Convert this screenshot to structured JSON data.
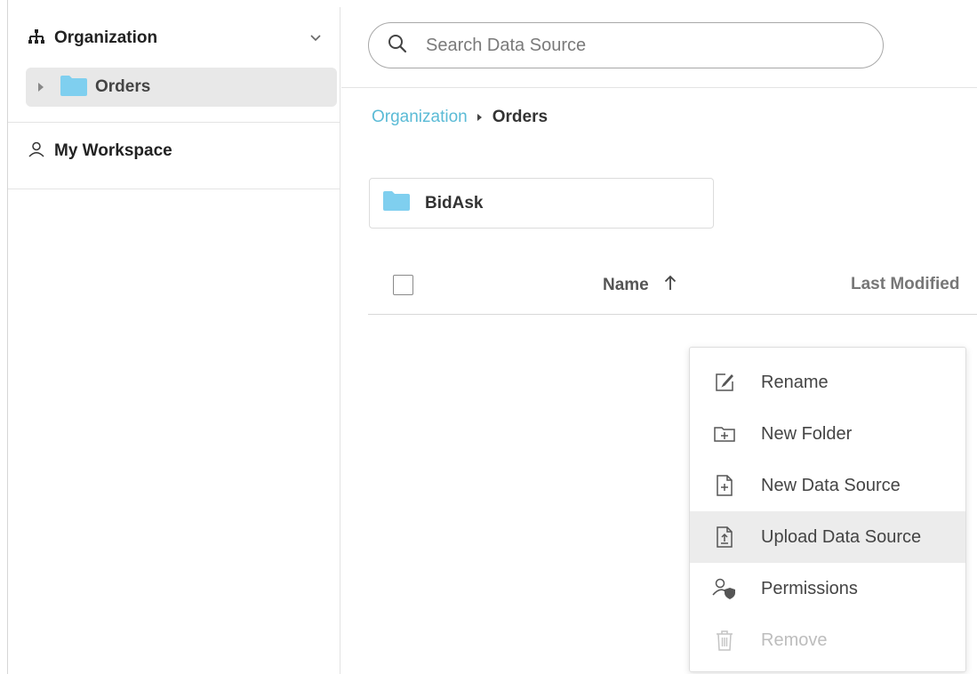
{
  "sidebar": {
    "organization": {
      "label": "Organization"
    },
    "orders": {
      "label": "Orders"
    },
    "workspace": {
      "label": "My Workspace"
    }
  },
  "search": {
    "placeholder": "Search Data Source"
  },
  "breadcrumb": {
    "root": "Organization",
    "current": "Orders"
  },
  "folders": [
    {
      "label": "BidAsk"
    }
  ],
  "table": {
    "columns": {
      "name": "Name",
      "last_modified": "Last Modified"
    },
    "sort": "ascending"
  },
  "context_menu": {
    "items": [
      {
        "label": "Rename",
        "icon": "rename-icon",
        "state": "normal"
      },
      {
        "label": "New Folder",
        "icon": "new-folder-icon",
        "state": "normal"
      },
      {
        "label": "New Data Source",
        "icon": "new-file-icon",
        "state": "normal"
      },
      {
        "label": "Upload Data Source",
        "icon": "upload-file-icon",
        "state": "hovered"
      },
      {
        "label": "Permissions",
        "icon": "permissions-icon",
        "state": "normal"
      },
      {
        "label": "Remove",
        "icon": "trash-icon",
        "state": "disabled"
      }
    ]
  },
  "colors": {
    "accent": "#5bbbd6",
    "folder": "#7fcfef",
    "hover": "#ececec",
    "disabled": "#bdbdbd"
  }
}
